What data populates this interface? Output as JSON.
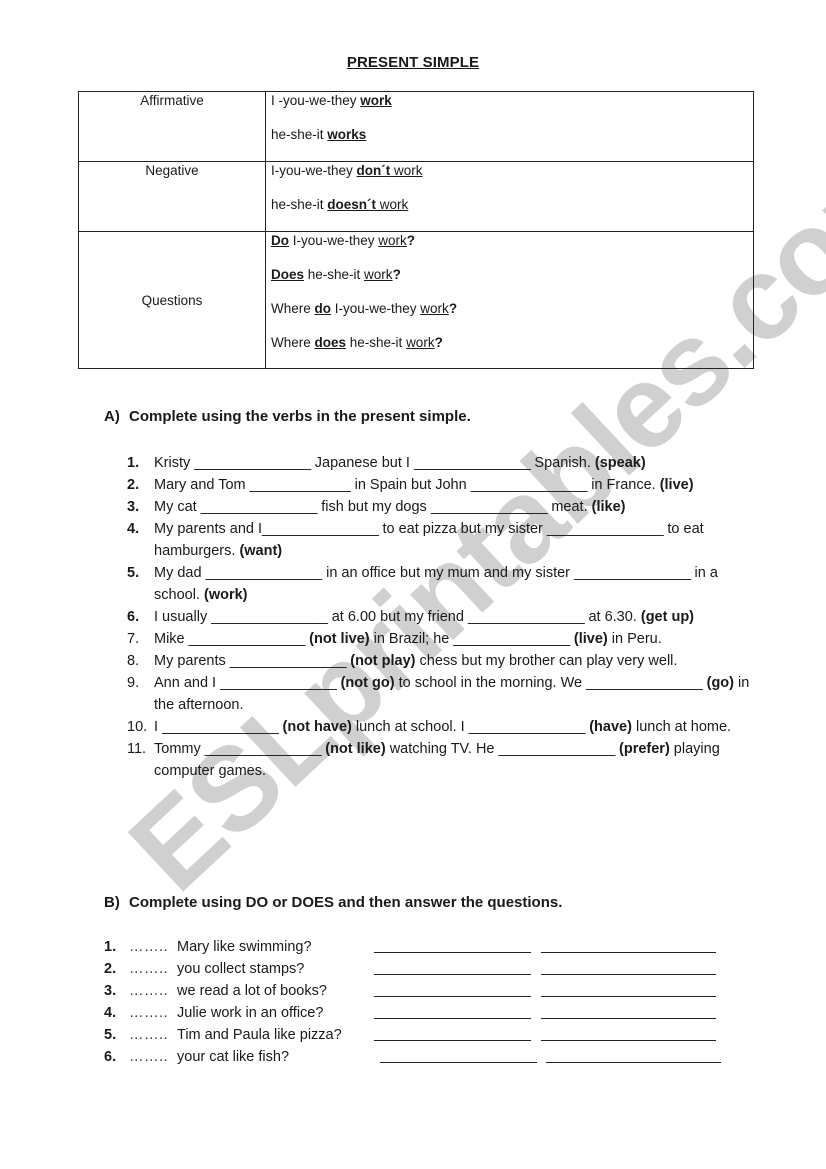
{
  "watermark": "ESLprintables.com",
  "title": "PRESENT SIMPLE",
  "grammar_table": {
    "rows": [
      {
        "label": "Affirmative",
        "lines": [
          {
            "pre": "I -you-we-they  ",
            "bold_u": "work",
            "plain_u": "",
            "post": ""
          },
          {
            "pre": "he-she-it  ",
            "bold_u": "works",
            "plain_u": "",
            "post": ""
          }
        ]
      },
      {
        "label": "Negative",
        "lines": [
          {
            "pre": "I-you-we-they  ",
            "bold_u": "don´t",
            "plain_u": " work",
            "post": ""
          },
          {
            "pre": "he-she-it  ",
            "bold_u": "doesn´t",
            "plain_u": " work",
            "post": ""
          }
        ]
      },
      {
        "label": "Questions",
        "lines": [
          {
            "lead_bold_u": "Do",
            "mid": "  I-you-we-they  ",
            "u": "work",
            "q": "?"
          },
          {
            "lead_bold_u": "Does",
            "mid": " he-she-it  ",
            "u": "work",
            "q": "?"
          },
          {
            "pre": "Where ",
            "bold_u": "do",
            "mid": " I-you-we-they  ",
            "u": "work",
            "q": "?"
          },
          {
            "pre": "Where ",
            "bold_u": "does",
            "mid": " he-she-it  ",
            "u": "work",
            "q": "?"
          }
        ]
      }
    ]
  },
  "section_a": {
    "letter": "A)",
    "instruction": "Complete using the verbs in the present simple.",
    "items": [
      {
        "num": "1.",
        "bold_num": true,
        "parts": [
          "Kristy ",
          "_______________",
          " Japanese but I ",
          "_______________",
          " Spanish. "
        ],
        "verb": "(speak)",
        "after": ""
      },
      {
        "num": "2.",
        "bold_num": true,
        "parts": [
          "Mary and Tom ",
          "_____________",
          " in Spain but John ",
          "_______________",
          " in France. "
        ],
        "verb": "(live)",
        "after": ""
      },
      {
        "num": "3.",
        "bold_num": true,
        "parts": [
          "My cat ",
          "_______________",
          " fish but my dogs ",
          "_______________",
          " meat. "
        ],
        "verb": "(like)",
        "after": ""
      },
      {
        "num": "4.",
        "bold_num": true,
        "parts": [
          "My parents and I",
          "_______________",
          " to eat pizza but my sister ",
          "_______________",
          " to eat hamburgers. "
        ],
        "verb": "(want)",
        "after": ""
      },
      {
        "num": "5.",
        "bold_num": true,
        "parts": [
          "My dad ",
          "_______________",
          " in an office but my mum and my sister ",
          "_______________",
          " in a school. "
        ],
        "verb": "(work)",
        "after": ""
      },
      {
        "num": "6.",
        "bold_num": true,
        "parts": [
          "I usually ",
          "_______________",
          " at 6.00 but my friend ",
          "_______________",
          " at 6.30. "
        ],
        "verb": "(get up)",
        "after": ""
      },
      {
        "num": "7.",
        "bold_num": false,
        "segments": [
          {
            "t": "Mike "
          },
          {
            "t": "_______________"
          },
          {
            "t": " (not live)",
            "b": true
          },
          {
            "t": " in Brazil; he "
          },
          {
            "t": "_______________"
          },
          {
            "t": " (live)",
            "b": true
          },
          {
            "t": " in Peru."
          }
        ]
      },
      {
        "num": "8.",
        "bold_num": false,
        "segments": [
          {
            "t": "My parents "
          },
          {
            "t": "_______________"
          },
          {
            "t": " (not play)",
            "b": true
          },
          {
            "t": " chess but my brother can play very well."
          }
        ]
      },
      {
        "num": "9.",
        "bold_num": false,
        "segments": [
          {
            "t": "Ann and I "
          },
          {
            "t": "_______________"
          },
          {
            "t": " (not go)",
            "b": true
          },
          {
            "t": " to school in the morning. We "
          },
          {
            "t": "_______________"
          },
          {
            "t": " (go)",
            "b": true
          },
          {
            "t": " in the afternoon."
          }
        ]
      },
      {
        "num": "10.",
        "bold_num": false,
        "segments": [
          {
            "t": "I "
          },
          {
            "t": "_______________"
          },
          {
            "t": " (not have)",
            "b": true
          },
          {
            "t": " lunch at school. I "
          },
          {
            "t": "_______________"
          },
          {
            "t": " (have)",
            "b": true
          },
          {
            "t": " lunch at home."
          }
        ]
      },
      {
        "num": "11.",
        "bold_num": false,
        "segments": [
          {
            "t": "Tommy "
          },
          {
            "t": "_______________"
          },
          {
            "t": " (not like)",
            "b": true
          },
          {
            "t": " watching TV. He "
          },
          {
            "t": "_______________"
          },
          {
            "t": " (prefer)",
            "b": true
          },
          {
            "t": " playing computer games."
          }
        ]
      }
    ]
  },
  "section_b": {
    "letter": "B)",
    "instruction": "Complete using DO or DOES and then answer the questions.",
    "items": [
      {
        "num": "1.",
        "dots": "……..",
        "question": "Mary like swimming?"
      },
      {
        "num": "2.",
        "dots": "……..",
        "question": "you collect stamps?"
      },
      {
        "num": "3.",
        "dots": "……..",
        "question": "we read a lot of books?"
      },
      {
        "num": "4.",
        "dots": "……..",
        "question": "Julie work in an office?"
      },
      {
        "num": "5.",
        "dots": "……..",
        "question": "Tim and Paula like pizza?"
      },
      {
        "num": "6.",
        "dots": "……..",
        "question": "your cat like fish?"
      }
    ]
  }
}
